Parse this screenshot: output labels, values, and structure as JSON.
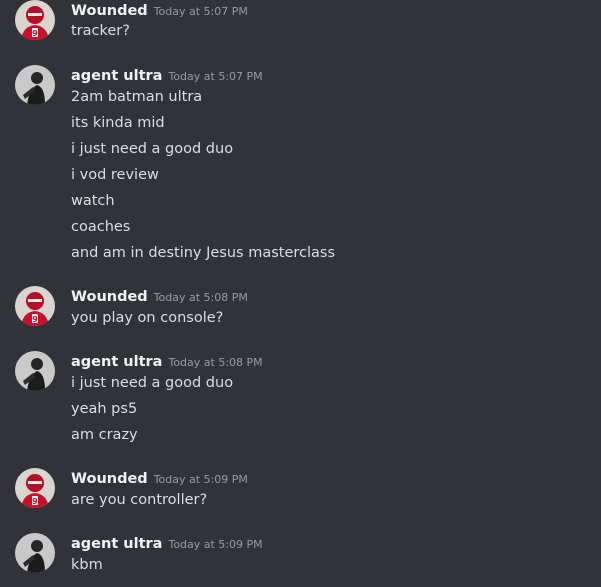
{
  "messages": [
    {
      "author": "Wounded",
      "timestamp": "Today at 5:07 PM",
      "lines": [
        "tracker?"
      ]
    },
    {
      "author": "agent ultra",
      "timestamp": "Today at 5:07 PM",
      "lines": [
        "2am batman ultra",
        "its kinda mid",
        "i just need a good duo",
        "i vod review",
        "watch",
        "coaches",
        "and am in destiny Jesus masterclass"
      ]
    },
    {
      "author": "Wounded",
      "timestamp": "Today at 5:08 PM",
      "lines": [
        "you play on console?"
      ]
    },
    {
      "author": "agent ultra",
      "timestamp": "Today at 5:08 PM",
      "lines": [
        "i just need a good duo",
        "yeah ps5",
        "am crazy"
      ]
    },
    {
      "author": "Wounded",
      "timestamp": "Today at 5:09 PM",
      "lines": [
        "are you controller?"
      ]
    },
    {
      "author": "agent ultra",
      "timestamp": "Today at 5:09 PM",
      "lines": [
        "kbm"
      ]
    }
  ],
  "avatar_badge_number": "9",
  "colors": {
    "background": "#313338",
    "username": "#f2f3f5",
    "timestamp": "#949ba4",
    "message_text": "#dbdee1",
    "wounded_avatar_jersey": "#c8102e"
  }
}
